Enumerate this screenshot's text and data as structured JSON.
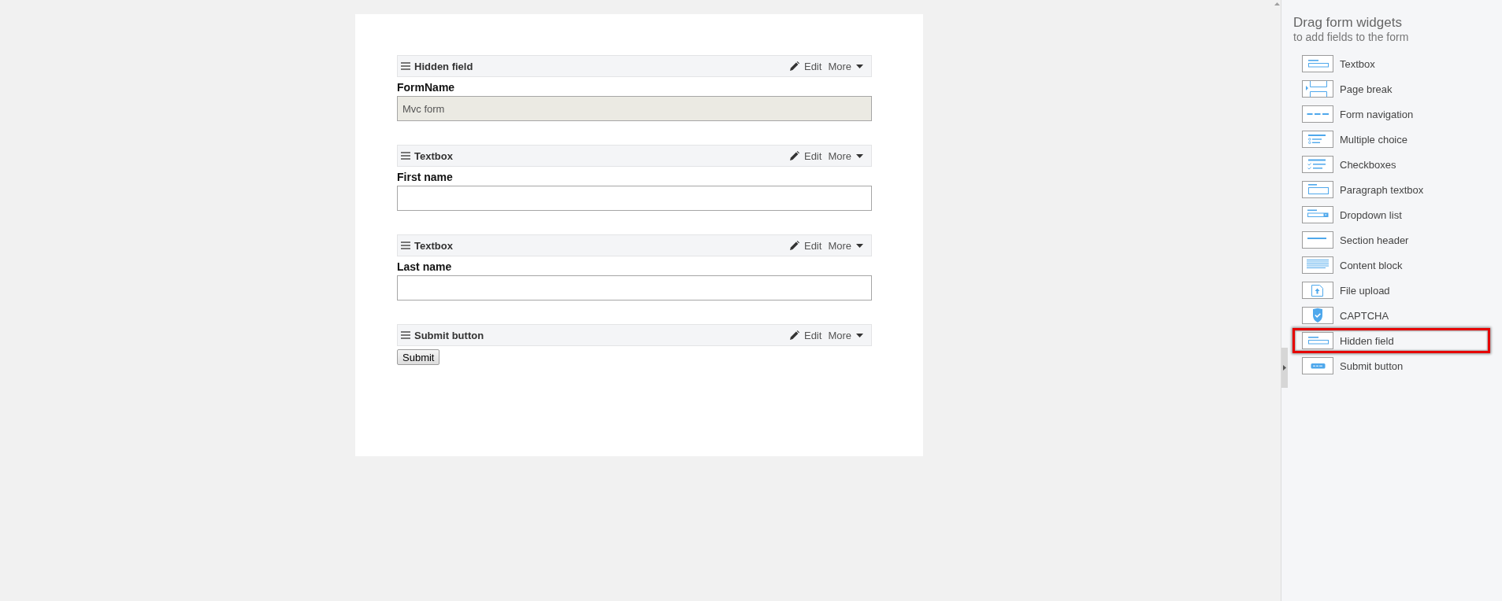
{
  "form": {
    "fields": [
      {
        "kind": "hidden",
        "widget": "Hidden field",
        "edit": "Edit",
        "more": "More",
        "label": "FormName",
        "value": "Mvc form"
      },
      {
        "kind": "textbox",
        "widget": "Textbox",
        "edit": "Edit",
        "more": "More",
        "label": "First name"
      },
      {
        "kind": "textbox",
        "widget": "Textbox",
        "edit": "Edit",
        "more": "More",
        "label": "Last name"
      },
      {
        "kind": "submit",
        "widget": "Submit button",
        "edit": "Edit",
        "more": "More",
        "button": "Submit"
      }
    ]
  },
  "sidebar": {
    "title": "Drag form widgets",
    "subtitle": "to add fields to the form",
    "widgets": [
      {
        "kind": "textbox",
        "label": "Textbox",
        "highlighted": false
      },
      {
        "kind": "page-break",
        "label": "Page break",
        "highlighted": false
      },
      {
        "kind": "navigation",
        "label": "Form navigation",
        "highlighted": false
      },
      {
        "kind": "multiple-choice",
        "label": "Multiple choice",
        "highlighted": false
      },
      {
        "kind": "checkboxes",
        "label": "Checkboxes",
        "highlighted": false
      },
      {
        "kind": "paragraph",
        "label": "Paragraph textbox",
        "highlighted": false
      },
      {
        "kind": "dropdown",
        "label": "Dropdown list",
        "highlighted": false
      },
      {
        "kind": "section-header",
        "label": "Section header",
        "highlighted": false
      },
      {
        "kind": "content-block",
        "label": "Content block",
        "highlighted": false
      },
      {
        "kind": "file-upload",
        "label": "File upload",
        "highlighted": false
      },
      {
        "kind": "captcha",
        "label": "CAPTCHA",
        "highlighted": false
      },
      {
        "kind": "hidden",
        "label": "Hidden field",
        "highlighted": true
      },
      {
        "kind": "submit",
        "label": "Submit button",
        "highlighted": false
      }
    ]
  }
}
